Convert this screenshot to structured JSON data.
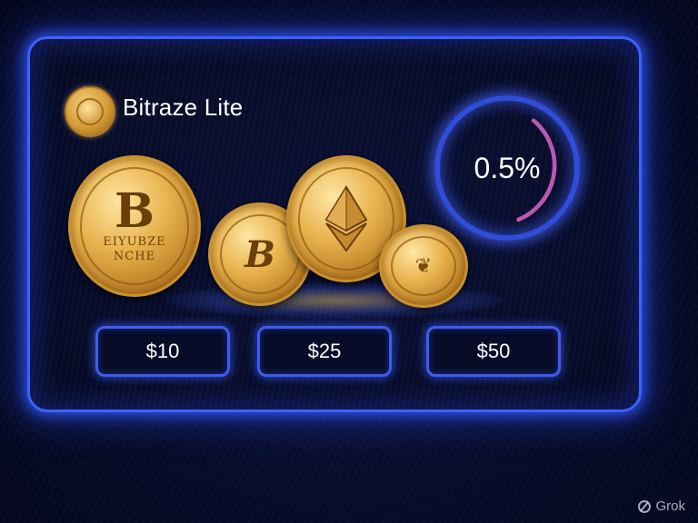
{
  "app": {
    "brand_name": "Bitraze Lite"
  },
  "rate": {
    "value_label": "0.5%",
    "ring_color": "#2f4dd8",
    "arc_color": "#d866c8"
  },
  "coins": {
    "main_glyph": "B",
    "main_text_line1": "EIYUBZE",
    "main_text_line2": "NCHE",
    "secondary_glyph": "B"
  },
  "amounts": [
    {
      "label": "$10"
    },
    {
      "label": "$25"
    },
    {
      "label": "$50"
    }
  ],
  "theme": {
    "accent": "#3d63ff",
    "gold": "#e8b24d",
    "background": "#06091c"
  },
  "watermark": {
    "label": "Grok",
    "icon": "grok-logo-icon"
  }
}
